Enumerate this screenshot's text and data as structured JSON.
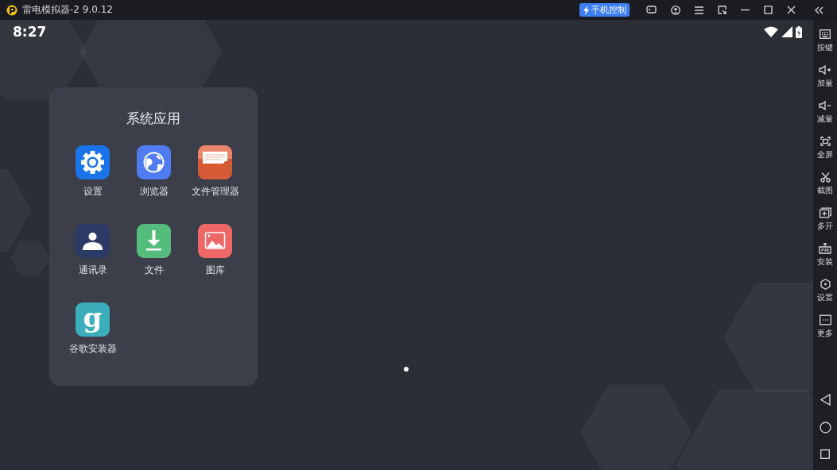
{
  "window": {
    "title": "雷电模拟器-2 9.0.12",
    "phone_control_button": "手机控制"
  },
  "status_bar": {
    "time": "8:27"
  },
  "folder": {
    "title": "系统应用",
    "apps": [
      {
        "kind": "settings",
        "label": "设置"
      },
      {
        "kind": "browser",
        "label": "浏览器"
      },
      {
        "kind": "file-manager",
        "label": "文件管理器"
      },
      {
        "kind": "contacts",
        "label": "通讯录"
      },
      {
        "kind": "download",
        "label": "文件"
      },
      {
        "kind": "gallery",
        "label": "图库"
      },
      {
        "kind": "glyph",
        "glyph": "g",
        "label": "谷歌安装器"
      }
    ]
  },
  "pages": [
    {
      "selected": true
    }
  ],
  "sidebar": {
    "items": [
      {
        "kind": "keyboard",
        "label": "按键"
      },
      {
        "kind": "volume-up",
        "label": "加量"
      },
      {
        "kind": "volume-down",
        "label": "减量"
      },
      {
        "kind": "fullscreen",
        "label": "全屏"
      },
      {
        "kind": "scissors",
        "label": "截图"
      },
      {
        "kind": "multi",
        "label": "多开"
      },
      {
        "kind": "apk",
        "label": "安装"
      },
      {
        "kind": "settings",
        "label": "设置"
      },
      {
        "kind": "more",
        "label": "更多"
      }
    ]
  }
}
